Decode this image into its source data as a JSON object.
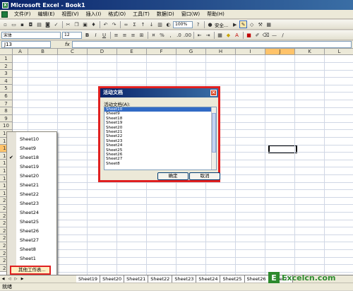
{
  "window": {
    "title": "Microsoft Excel - Book1"
  },
  "menu": [
    "文件(F)",
    "编辑(E)",
    "视图(V)",
    "插入(I)",
    "格式(O)",
    "工具(T)",
    "数据(D)",
    "窗口(W)",
    "帮助(H)"
  ],
  "toolbar": {
    "zoom": "100%",
    "font": "宋体",
    "size": "12",
    "security": "安全..."
  },
  "formula": {
    "namebox": "J13",
    "fx": "fx"
  },
  "columns": [
    "A",
    "B",
    "C",
    "D",
    "E",
    "F",
    "G",
    "H",
    "I",
    "J",
    "K",
    "L"
  ],
  "rows": [
    "1",
    "2",
    "3",
    "4",
    "5",
    "6",
    "7",
    "8",
    "9",
    "10",
    "11",
    "12",
    "13",
    "14",
    "15",
    "16",
    "17",
    "18",
    "19",
    "20",
    "21",
    "22",
    "23",
    "24",
    "25",
    "26",
    "27",
    "28",
    "29"
  ],
  "context_menu": {
    "items": [
      "Sheet10",
      "Sheet9",
      "Sheet18",
      "Sheet19",
      "Sheet20",
      "Sheet21",
      "Sheet22",
      "Sheet23",
      "Sheet24",
      "Sheet25",
      "Sheet26",
      "Sheet27",
      "Sheet8",
      "Sheet1"
    ],
    "more": "其他工作表..."
  },
  "dialog": {
    "title": "活动文档",
    "label": "活动文档(A):",
    "items": [
      "Sheet10",
      "Sheet9",
      "Sheet18",
      "Sheet19",
      "Sheet20",
      "Sheet21",
      "Sheet22",
      "Sheet23",
      "Sheet24",
      "Sheet25",
      "Sheet26",
      "Sheet27",
      "Sheet8"
    ],
    "ok": "确定",
    "cancel": "取消"
  },
  "tabs": [
    "Sheet19",
    "Sheet20",
    "Sheet21",
    "Sheet22",
    "Sheet23",
    "Sheet24",
    "Sheet25",
    "Sheet26",
    "Sheet27"
  ],
  "status": "就绪",
  "watermark": "Excelcn.com"
}
